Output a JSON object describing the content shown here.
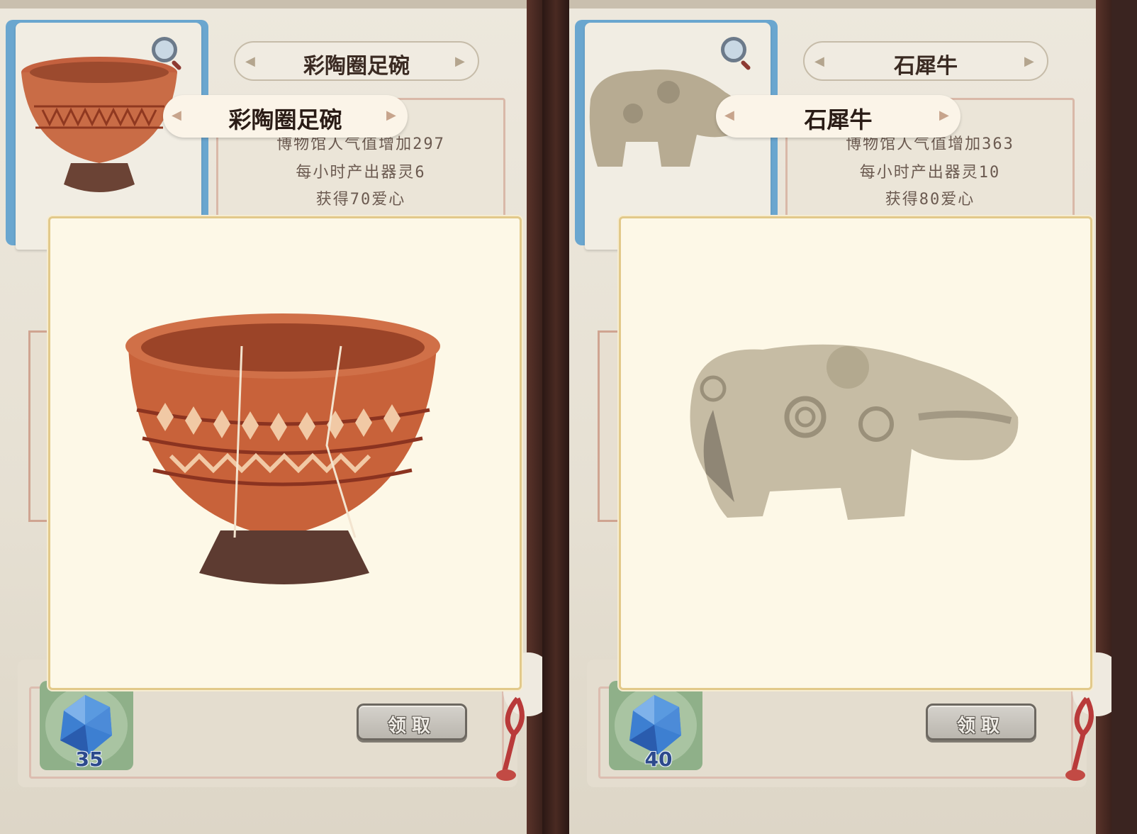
{
  "panels": [
    {
      "title": "彩陶圈足碗",
      "overlay_name": "彩陶圈足碗",
      "info": {
        "line1": "博物馆人气值增加297",
        "line2": "每小时产出器灵6",
        "line3": "获得70爱心"
      },
      "reward_count": "35",
      "claim_label": "领取",
      "artifact_icon": "painted-pottery-bowl",
      "colors": {
        "accent": "#b0452a",
        "banner": "#fbf4e8"
      }
    },
    {
      "title": "石犀牛",
      "overlay_name": "石犀牛",
      "info": {
        "line1": "博物馆人气值增加363",
        "line2": "每小时产出器灵10",
        "line3": "获得80爱心"
      },
      "reward_count": "40",
      "claim_label": "领取",
      "artifact_icon": "stone-rhinoceros",
      "colors": {
        "accent": "#9a8f78",
        "banner": "#fbf4e8"
      }
    }
  ],
  "icons": {
    "magnifier": "magnifier-icon",
    "gem": "blue-gem-icon",
    "chevron": "chevron-icon"
  }
}
